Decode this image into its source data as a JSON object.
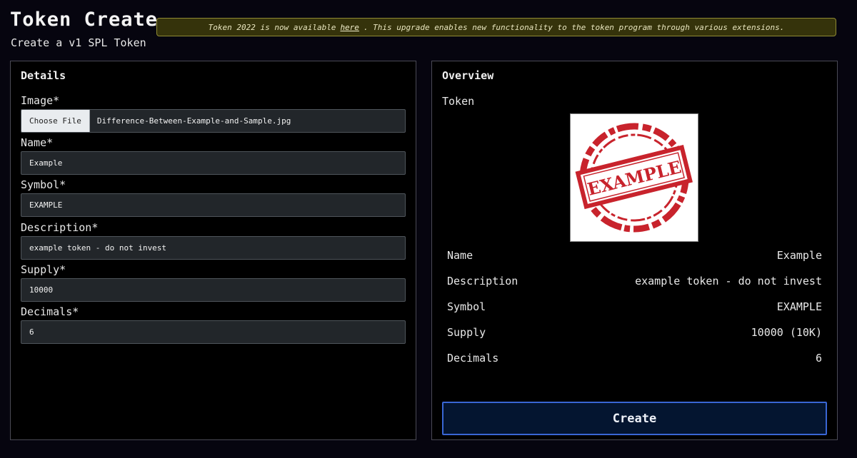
{
  "header": {
    "title": "Token Create",
    "subtitle": "Create a v1 SPL Token"
  },
  "notice": {
    "text_before": "Token 2022 is now available",
    "link_text": "here",
    "text_after": ". This upgrade enables new functionality to the token program through various extensions."
  },
  "details": {
    "heading": "Details",
    "image_label": "Image*",
    "file_button_label": "Choose File",
    "file_name": "Difference-Between-Example-and-Sample.jpg",
    "name_label": "Name*",
    "name_value": "Example",
    "symbol_label": "Symbol*",
    "symbol_value": "EXAMPLE",
    "description_label": "Description*",
    "description_value": "example token - do not invest",
    "supply_label": "Supply*",
    "supply_value": "10000",
    "decimals_label": "Decimals*",
    "decimals_value": "6"
  },
  "overview": {
    "heading": "Overview",
    "token_label": "Token",
    "image_stamp_text": "EXAMPLE",
    "rows": [
      {
        "label": "Name",
        "value": "Example"
      },
      {
        "label": "Description",
        "value": "example token - do not invest"
      },
      {
        "label": "Symbol",
        "value": "EXAMPLE"
      },
      {
        "label": "Supply",
        "value": "10000 (10K)"
      },
      {
        "label": "Decimals",
        "value": "6"
      }
    ],
    "create_button_label": "Create"
  },
  "colors": {
    "background": "#06050f",
    "notice_bg": "#35330b",
    "notice_border": "#8f8a33",
    "button_border": "#3966d4",
    "stamp_red": "#c8232c"
  }
}
